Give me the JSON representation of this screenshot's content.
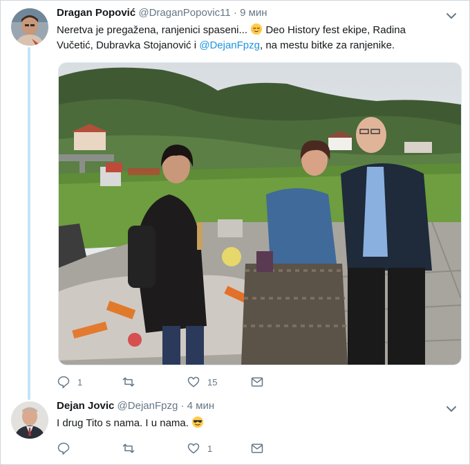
{
  "tweet1": {
    "name": "Dragan Popović",
    "handle": "@DraganPopovic11",
    "separator": "·",
    "time": "9 мин",
    "text_part1": "Neretva je pregažena, ranjenici spaseni...",
    "text_part2": "Deo History fest ekipe, Radina Vučetić, Dubravka Stojanović i",
    "mention": "@DejanFpzg",
    "text_part3": ", na mestu bitke za ranjenike.",
    "emoji": "relieved-face-emoji",
    "reply_count": "1",
    "retweet_count": "",
    "like_count": "15"
  },
  "tweet2": {
    "name": "Dejan Jovic",
    "handle": "@DejanFpzg",
    "separator": "·",
    "time": "4 мин",
    "text": "I drug Tito s nama. I u nama.",
    "emoji": "sunglasses-face-emoji",
    "reply_count": "",
    "retweet_count": "",
    "like_count": "1"
  },
  "icons": {
    "reply": "reply-icon",
    "retweet": "retweet-icon",
    "like": "heart-icon",
    "message": "envelope-icon",
    "more": "chevron-down-icon"
  },
  "colors": {
    "link": "#1b95e0",
    "muted": "#657786",
    "thread_line": "#c4e3f7"
  }
}
